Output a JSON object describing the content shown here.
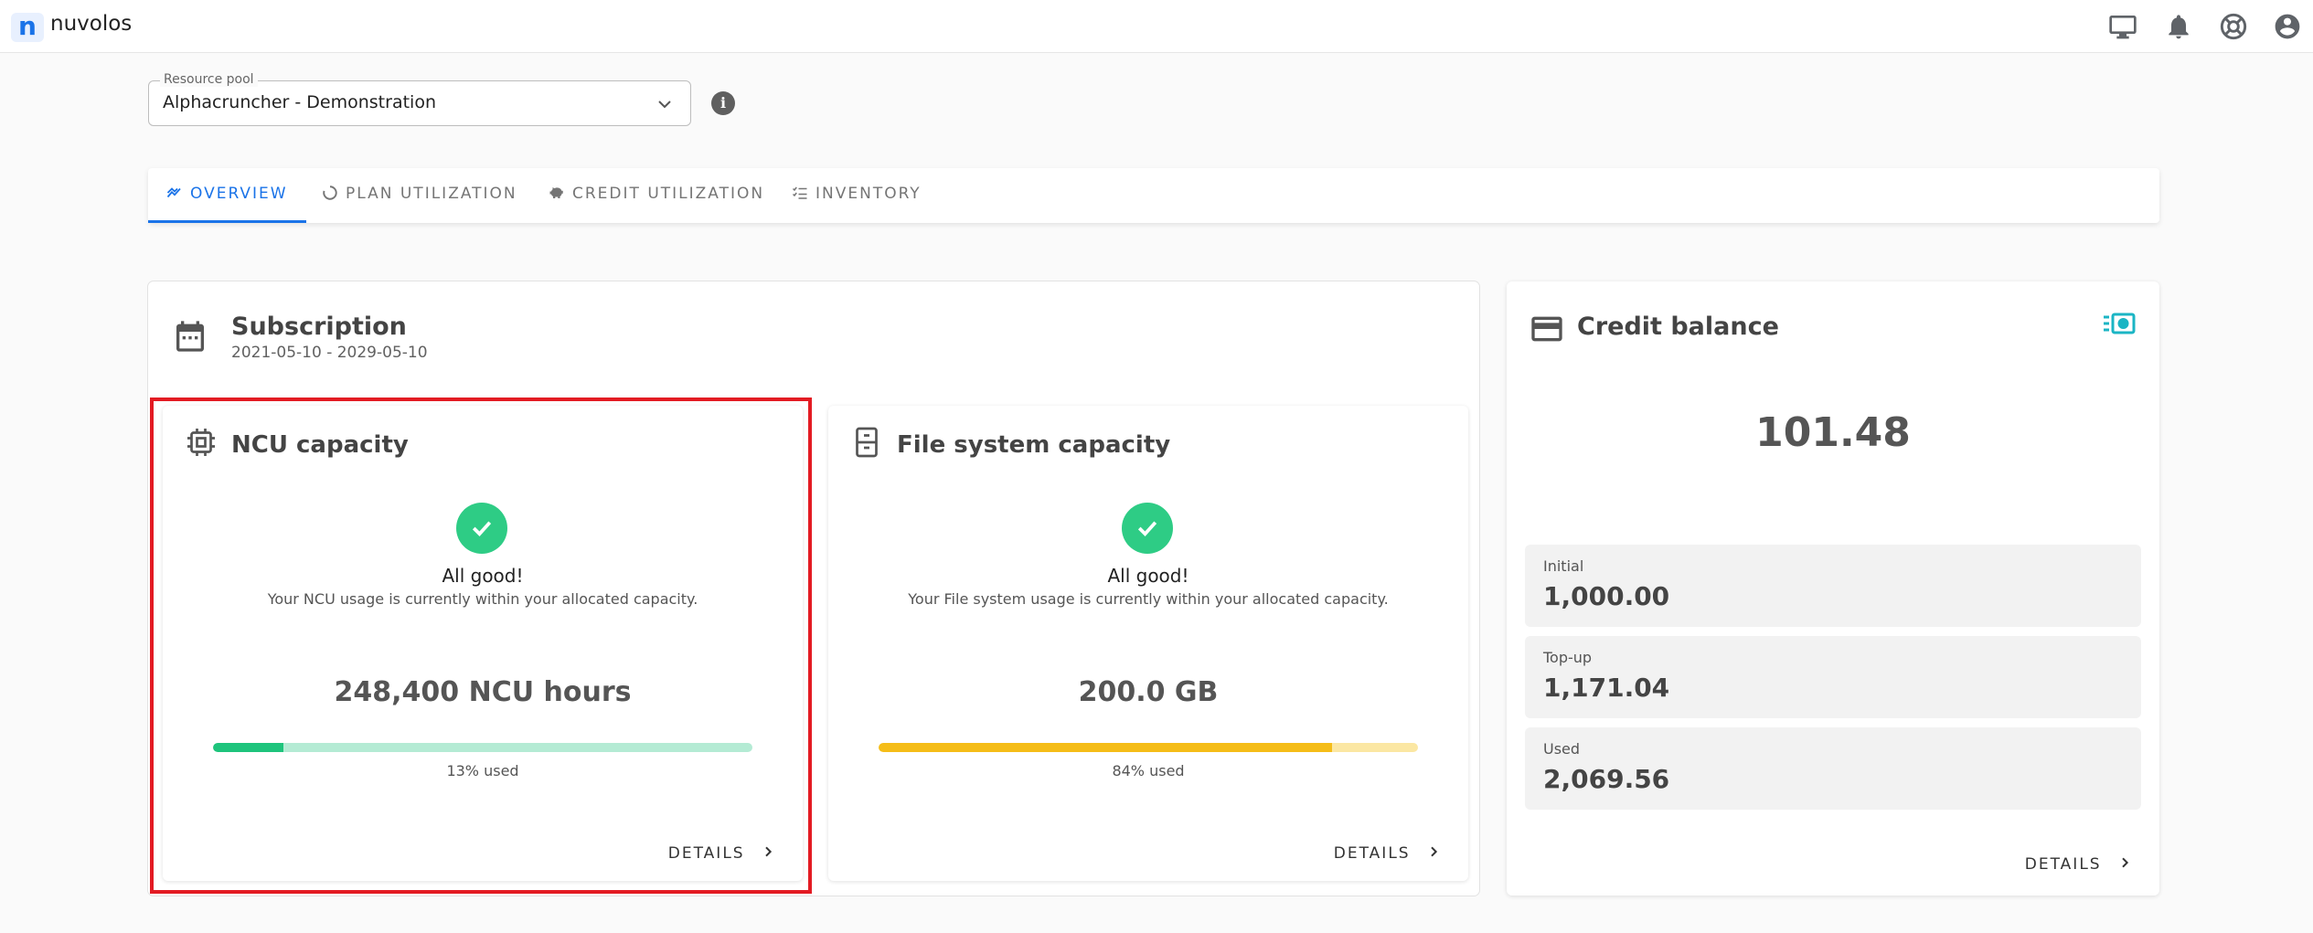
{
  "app": {
    "brand": "nuvolos",
    "logo_letter": "n"
  },
  "topbar": {
    "icons": [
      "monitor-icon",
      "bell-icon",
      "lifebuoy-icon",
      "account-icon"
    ]
  },
  "resource_pool": {
    "label": "Resource pool",
    "value": "Alphacruncher - Demonstration"
  },
  "tabs": [
    {
      "label": "OVERVIEW",
      "icon": "chart-line-icon",
      "active": true
    },
    {
      "label": "PLAN UTILIZATION",
      "icon": "circle-progress-icon",
      "active": false
    },
    {
      "label": "CREDIT UTILIZATION",
      "icon": "piggy-bank-icon",
      "active": false
    },
    {
      "label": "INVENTORY",
      "icon": "checklist-icon",
      "active": false
    }
  ],
  "subscription": {
    "title": "Subscription",
    "dates": "2021-05-10 - 2029-05-10",
    "ncu": {
      "title": "NCU capacity",
      "status": "All good!",
      "message": "Your NCU usage is currently within your allocated capacity.",
      "amount": "248,400 NCU hours",
      "used_label": "13% used",
      "used_fraction": 0.13,
      "details": "DETAILS",
      "fill_color": "#1ec47c",
      "track_color": "#b4ebd4"
    },
    "fs": {
      "title": "File system capacity",
      "status": "All good!",
      "message": "Your File system usage is currently within your allocated capacity.",
      "amount": "200.0 GB",
      "used_label": "84% used",
      "used_fraction": 0.84,
      "details": "DETAILS",
      "fill_color": "#f5bd18",
      "track_color": "#fbe7a3"
    }
  },
  "credit": {
    "title": "Credit balance",
    "balance": "101.48",
    "rows": [
      {
        "label": "Initial",
        "value": "1,000.00"
      },
      {
        "label": "Top-up",
        "value": "1,171.04"
      },
      {
        "label": "Used",
        "value": "2,069.56"
      }
    ],
    "details": "DETAILS"
  },
  "colors": {
    "accent": "#1a73e8",
    "success": "#2ecc85",
    "highlight": "#e31b23",
    "cash": "#1bb5c4"
  }
}
